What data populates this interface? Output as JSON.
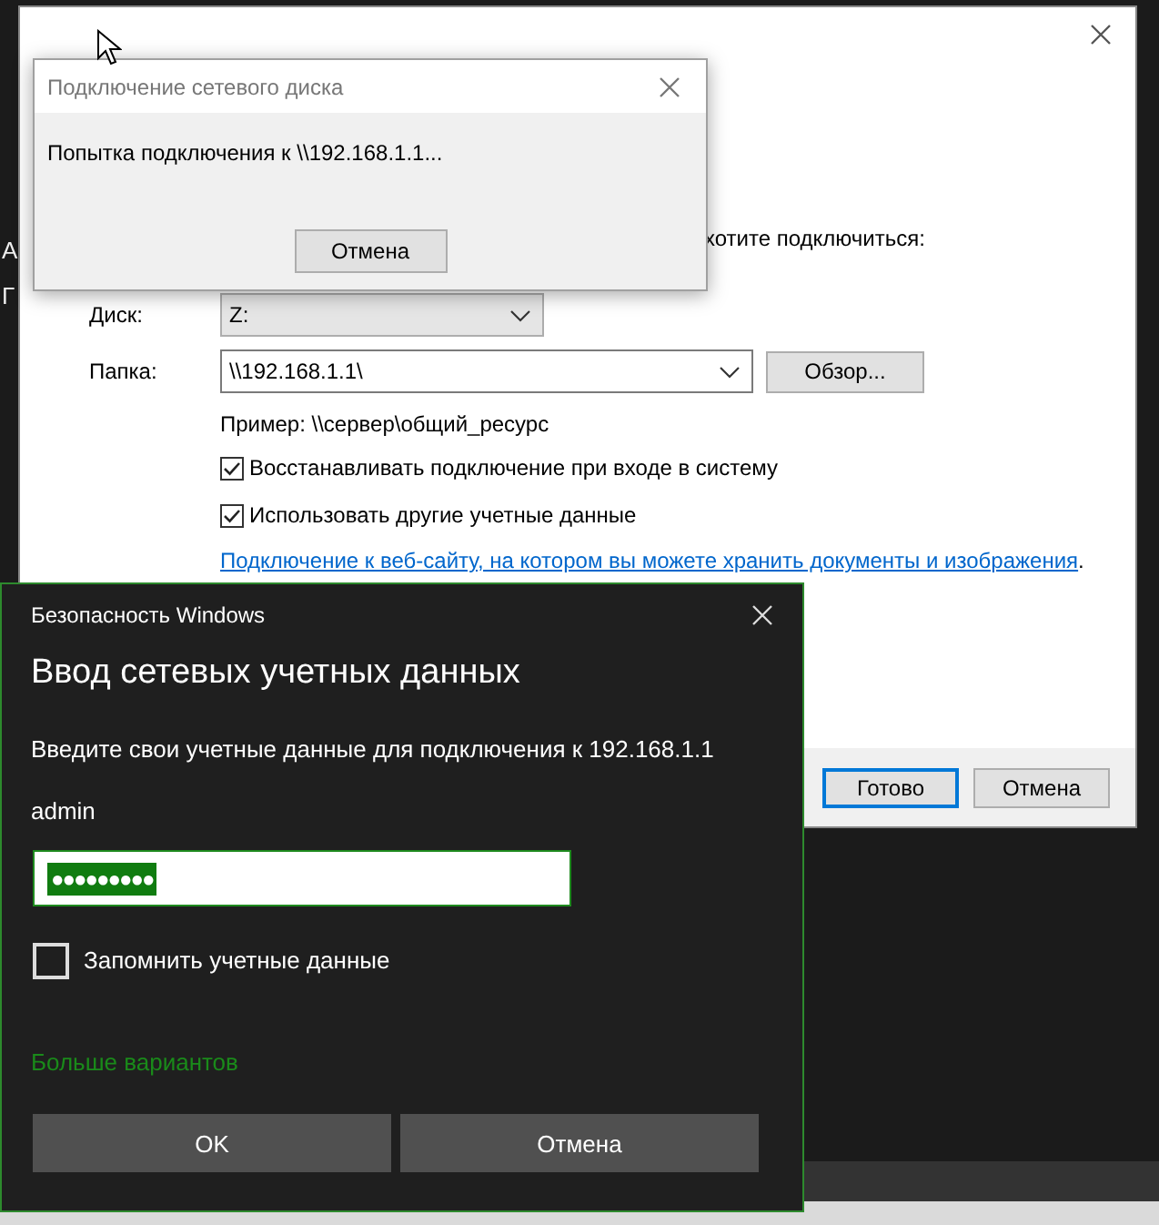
{
  "background_fragments": [
    "A",
    "Г"
  ],
  "map_drive_window": {
    "prompt": "хотите подключиться:",
    "fields": [
      {
        "kind": "drive",
        "label": "Диск:",
        "value": "Z:"
      },
      {
        "kind": "folder",
        "label": "Папка:",
        "value": "\\\\192.168.1.1\\"
      }
    ],
    "browse_button": "Обзор...",
    "example": "Пример: \\\\сервер\\общий_ресурс",
    "options": [
      {
        "label": "Восстанавливать подключение при входе в систему",
        "checked": true
      },
      {
        "label": "Использовать другие учетные данные",
        "checked": true
      }
    ],
    "link": "Подключение к веб-сайту, на котором вы можете хранить документы и изображения",
    "link_suffix": ".",
    "buttons": [
      {
        "label": "Готово",
        "default": true
      },
      {
        "label": "Отмена",
        "default": false
      }
    ]
  },
  "progress_dialog": {
    "title": "Подключение сетевого диска",
    "message": "Попытка подключения к \\\\192.168.1.1...",
    "button": "Отмена"
  },
  "credentials_dialog": {
    "caption": "Безопасность Windows",
    "heading": "Ввод сетевых учетных данных",
    "description": "Введите свои учетные данные для подключения к 192.168.1.1",
    "username": "admin",
    "password": {
      "mask": "●●●●●●●●●",
      "selected": true
    },
    "remember": {
      "label": "Запомнить учетные данные",
      "checked": false
    },
    "more_options": "Больше вариантов",
    "buttons": [
      "OK",
      "Отмена"
    ]
  }
}
